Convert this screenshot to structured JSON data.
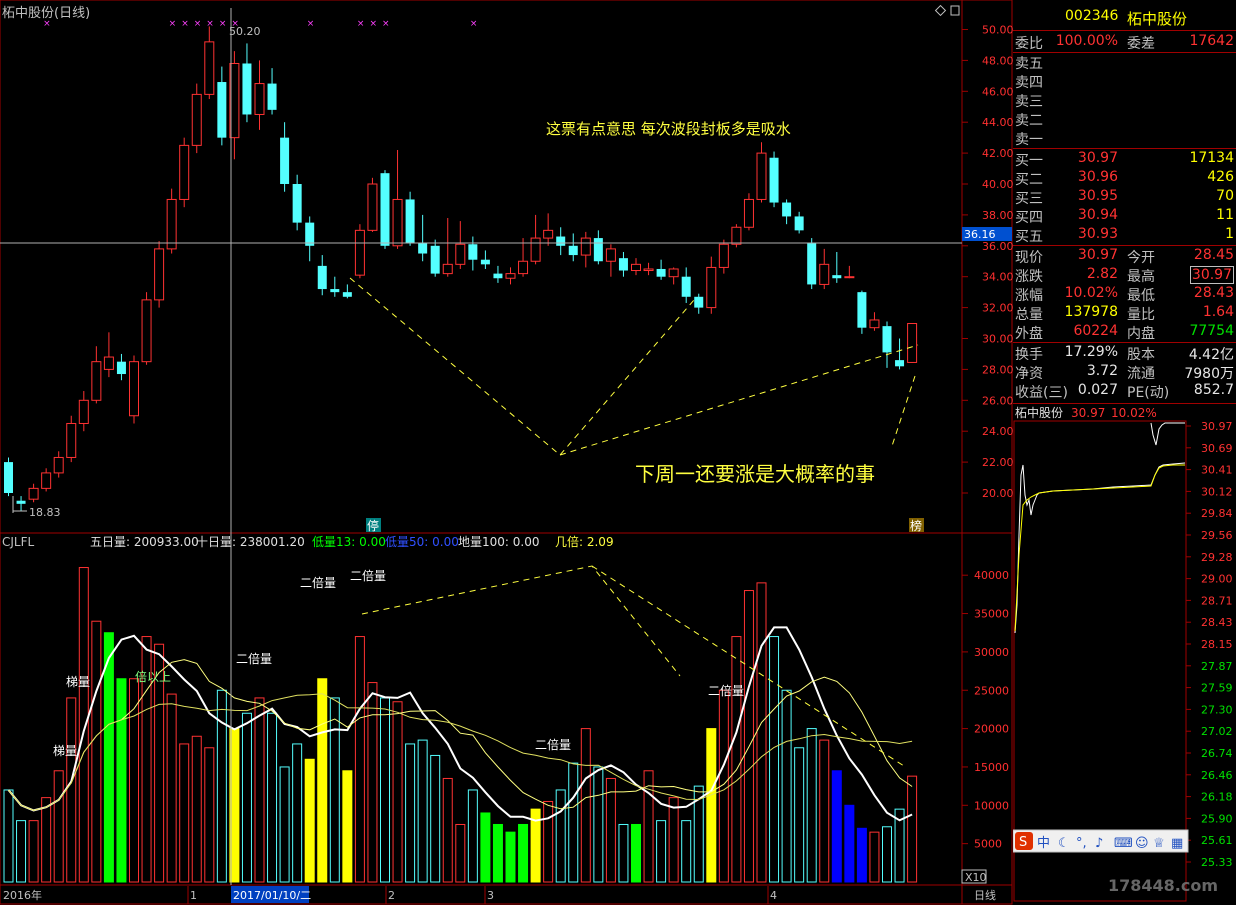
{
  "main_chart": {
    "title": "柘中股份(日线)",
    "high_marker": "50.20",
    "low_marker": "18.83",
    "crosshair_price": "36.16",
    "stop_tag": "停",
    "list_tag": "榜",
    "annotation_top": "这票有点意思 每次波段封板多是吸水",
    "annotation_bottom": "下周一还要涨是大概率的事",
    "price_axis": [
      "50.00",
      "48.00",
      "46.00",
      "44.00",
      "42.00",
      "40.00",
      "38.00",
      "36.00",
      "34.00",
      "32.00",
      "30.00",
      "28.00",
      "26.00",
      "24.00",
      "22.00",
      "20.00"
    ]
  },
  "volume_chart": {
    "indicator_name": "CJLFL",
    "five_day": "五日量: 200933.00",
    "ten_day": "十日量: 238001.20",
    "low13": "低量13: 0.00",
    "low50": "低量50: 0.00",
    "ground100": "地量100: 0.00",
    "multiple": "几倍: 2.09",
    "labels": {
      "double": "二倍量",
      "ladder": "梯量",
      "multi": "倍以上"
    },
    "volume_axis": [
      "40000",
      "35000",
      "30000",
      "25000",
      "20000",
      "15000",
      "10000",
      "5000"
    ],
    "axis_unit": "X10"
  },
  "date_axis": {
    "labels": [
      "2016年",
      "1",
      "2017/01/10/二",
      "2",
      "3",
      "4"
    ],
    "period": "日线"
  },
  "quote": {
    "code": "002346",
    "name": "柘中股份",
    "weibi_label": "委比",
    "weibi": "100.00%",
    "weicha_label": "委差",
    "weicha": "17642",
    "asks": [
      {
        "label": "卖五"
      },
      {
        "label": "卖四"
      },
      {
        "label": "卖三"
      },
      {
        "label": "卖二"
      },
      {
        "label": "卖一"
      }
    ],
    "bids": [
      {
        "label": "买一",
        "price": "30.97",
        "vol": "17134"
      },
      {
        "label": "买二",
        "price": "30.96",
        "vol": "426"
      },
      {
        "label": "买三",
        "price": "30.95",
        "vol": "70"
      },
      {
        "label": "买四",
        "price": "30.94",
        "vol": "11"
      },
      {
        "label": "买五",
        "price": "30.93",
        "vol": "1"
      }
    ],
    "stats": [
      {
        "l1": "现价",
        "v1": "30.97",
        "l2": "今开",
        "v2": "28.45"
      },
      {
        "l1": "涨跌",
        "v1": "2.82",
        "l2": "最高",
        "v2": "30.97"
      },
      {
        "l1": "涨幅",
        "v1": "10.02%",
        "l2": "最低",
        "v2": "28.43"
      },
      {
        "l1": "总量",
        "v1": "137978",
        "l2": "量比",
        "v2": "1.64"
      },
      {
        "l1": "外盘",
        "v1": "60224",
        "l2": "内盘",
        "v2": "77754"
      }
    ],
    "stats2": [
      {
        "l1": "换手",
        "v1": "17.29%",
        "l2": "股本",
        "v2": "4.42亿"
      },
      {
        "l1": "净资",
        "v1": "3.72",
        "l2": "流通",
        "v2": "7980万"
      },
      {
        "l1": "收益(三)",
        "v1": "0.027",
        "l2": "PE(动)",
        "v2": "852.7"
      }
    ]
  },
  "intraday": {
    "title": "柘中股份",
    "price": "30.97",
    "pct": "10.02%",
    "axis": [
      "30.97",
      "30.69",
      "30.41",
      "30.12",
      "29.84",
      "29.56",
      "29.28",
      "29.00",
      "28.71",
      "28.43",
      "28.15",
      "27.87",
      "27.59",
      "27.30",
      "27.02",
      "26.74",
      "26.46",
      "26.18",
      "25.90",
      "25.61",
      "25.33"
    ]
  },
  "toolbar": {
    "zh": "中"
  },
  "watermark": "178448.com",
  "chart_data": {
    "type": "candlestick",
    "title": "柘中股份(日线)",
    "ylim": [
      18,
      51
    ],
    "candles": [
      [
        22.0,
        20.0,
        22.3,
        19.8
      ],
      [
        19.5,
        19.3,
        19.8,
        18.83
      ],
      [
        19.6,
        20.3,
        20.6,
        19.4
      ],
      [
        20.3,
        21.3,
        21.6,
        20.1
      ],
      [
        21.3,
        22.3,
        22.7,
        21.0
      ],
      [
        22.3,
        24.5,
        25.0,
        22.0
      ],
      [
        24.5,
        26.0,
        26.6,
        24.0
      ],
      [
        26.0,
        28.5,
        29.5,
        25.8
      ],
      [
        28.0,
        28.8,
        30.4,
        27.5
      ],
      [
        28.5,
        27.7,
        29.0,
        27.3
      ],
      [
        25.0,
        28.5,
        28.9,
        24.5
      ],
      [
        28.5,
        32.5,
        33.0,
        28.3
      ],
      [
        32.5,
        35.8,
        36.3,
        32.0
      ],
      [
        35.8,
        39.0,
        39.7,
        35.5
      ],
      [
        39.0,
        42.5,
        43.0,
        38.5
      ],
      [
        42.5,
        45.8,
        46.5,
        42.0
      ],
      [
        45.8,
        49.2,
        50.2,
        45.5
      ],
      [
        46.6,
        43.0,
        47.6,
        42.5
      ],
      [
        43.0,
        47.8,
        48.6,
        41.6
      ],
      [
        47.8,
        44.5,
        49.1,
        44.0
      ],
      [
        44.5,
        46.5,
        48.0,
        43.5
      ],
      [
        46.5,
        44.8,
        47.5,
        44.5
      ],
      [
        43.0,
        40.0,
        44.0,
        39.5
      ],
      [
        40.0,
        37.5,
        40.6,
        37.0
      ],
      [
        37.5,
        36.0,
        37.9,
        35.0
      ],
      [
        34.7,
        33.2,
        35.4,
        32.8
      ],
      [
        33.2,
        33.0,
        34.0,
        32.7
      ],
      [
        33.0,
        32.7,
        33.5,
        32.6
      ],
      [
        34.1,
        37.0,
        37.4,
        33.9
      ],
      [
        37.0,
        40.0,
        40.4,
        36.9
      ],
      [
        40.7,
        36.0,
        40.9,
        35.8
      ],
      [
        36.0,
        39.0,
        42.2,
        35.8
      ],
      [
        39.0,
        36.2,
        39.5,
        36.0
      ],
      [
        36.2,
        35.5,
        38.0,
        35.0
      ],
      [
        36.0,
        34.2,
        36.4,
        34.0
      ],
      [
        34.2,
        34.8,
        37.8,
        34.0
      ],
      [
        34.8,
        36.1,
        37.6,
        34.5
      ],
      [
        36.1,
        35.1,
        36.6,
        34.4
      ],
      [
        35.1,
        34.8,
        35.7,
        34.5
      ],
      [
        34.2,
        33.9,
        34.7,
        33.6
      ],
      [
        33.9,
        34.2,
        34.6,
        33.5
      ],
      [
        34.2,
        35.0,
        36.5,
        34.0
      ],
      [
        35.0,
        36.5,
        38.0,
        34.8
      ],
      [
        36.5,
        37.0,
        38.1,
        36.0
      ],
      [
        36.6,
        36.0,
        37.2,
        35.4
      ],
      [
        36.0,
        35.4,
        36.8,
        35.0
      ],
      [
        35.4,
        36.5,
        36.9,
        34.6
      ],
      [
        36.5,
        35.0,
        37.0,
        34.8
      ],
      [
        35.0,
        35.8,
        36.1,
        34.0
      ],
      [
        35.2,
        34.4,
        35.6,
        34.0
      ],
      [
        34.4,
        34.8,
        35.2,
        34.1
      ],
      [
        34.4,
        34.5,
        34.9,
        34.1
      ],
      [
        34.5,
        34.0,
        35.1,
        33.8
      ],
      [
        34.0,
        34.5,
        34.6,
        33.5
      ],
      [
        34.0,
        32.7,
        34.6,
        32.3
      ],
      [
        32.7,
        32.0,
        32.9,
        31.6
      ],
      [
        32.0,
        34.6,
        35.3,
        31.6
      ],
      [
        34.6,
        36.1,
        36.4,
        34.2
      ],
      [
        36.1,
        37.2,
        37.4,
        35.9
      ],
      [
        37.2,
        39.0,
        39.4,
        37.0
      ],
      [
        39.0,
        42.0,
        42.7,
        38.8
      ],
      [
        41.7,
        38.8,
        42.1,
        38.5
      ],
      [
        38.8,
        37.9,
        39.0,
        37.4
      ],
      [
        37.9,
        37.0,
        38.2,
        36.8
      ],
      [
        36.2,
        33.5,
        36.5,
        33.2
      ],
      [
        33.5,
        34.8,
        35.8,
        33.2
      ],
      [
        34.1,
        33.9,
        35.6,
        33.6
      ],
      [
        34.0,
        34.0,
        34.7,
        33.9
      ],
      [
        33.0,
        30.7,
        33.1,
        30.3
      ],
      [
        30.7,
        31.2,
        31.7,
        30.5
      ],
      [
        30.8,
        29.1,
        31.1,
        28.1
      ],
      [
        28.6,
        28.2,
        30.0,
        28.0
      ],
      [
        28.45,
        30.97,
        30.97,
        28.43
      ]
    ],
    "volume_axis_ylim": [
      0,
      40000
    ]
  }
}
